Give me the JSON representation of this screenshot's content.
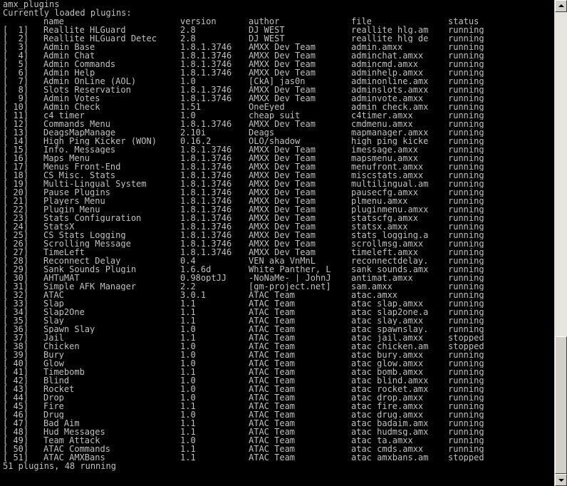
{
  "console": {
    "command": "amx_plugins",
    "heading": "Currently loaded plugins:",
    "columns": {
      "name": "name",
      "version": "version",
      "author": "author",
      "file": "file",
      "status": "status"
    },
    "plugins": [
      {
        "index": "[  1]",
        "name": "Reallite HLGuard",
        "version": "2.8",
        "author": "DJ_WEST",
        "file": "reallite_hlg.am",
        "status": "running"
      },
      {
        "index": "[  2]",
        "name": "Reallite HLGuard Detec",
        "version": "2.8",
        "author": "DJ_WEST",
        "file": "reallite_hlg_de",
        "status": "running"
      },
      {
        "index": "[  3]",
        "name": "Admin Base",
        "version": "1.8.1.3746",
        "author": "AMXX Dev Team",
        "file": "admin.amxx",
        "status": "running"
      },
      {
        "index": "[  4]",
        "name": "Admin Chat",
        "version": "1.8.1.3746",
        "author": "AMXX Dev Team",
        "file": "adminchat.amxx",
        "status": "running"
      },
      {
        "index": "[  5]",
        "name": "Admin Commands",
        "version": "1.8.1.3746",
        "author": "AMXX Dev Team",
        "file": "admincmd.amxx",
        "status": "running"
      },
      {
        "index": "[  6]",
        "name": "Admin Help",
        "version": "1.8.1.3746",
        "author": "AMXX Dev Team",
        "file": "adminhelp.amxx",
        "status": "running"
      },
      {
        "index": "[  7]",
        "name": "Admin OnLine (AOL)",
        "version": "1.0",
        "author": "[CkA] jas0n",
        "file": "adminonline.amx",
        "status": "running"
      },
      {
        "index": "[  8]",
        "name": "Slots Reservation",
        "version": "1.8.1.3746",
        "author": "AMXX Dev Team",
        "file": "adminslots.amxx",
        "status": "running"
      },
      {
        "index": "[  9]",
        "name": "Admin Votes",
        "version": "1.8.1.3746",
        "author": "AMXX Dev Team",
        "file": "adminvote.amxx",
        "status": "running"
      },
      {
        "index": "[ 10]",
        "name": "Admin Check",
        "version": "1.51",
        "author": "OneEyed",
        "file": "admin_check.amx",
        "status": "running"
      },
      {
        "index": "[ 11]",
        "name": "c4 timer",
        "version": "1.0",
        "author": "cheap_suit",
        "file": "c4timer.amxx",
        "status": "running"
      },
      {
        "index": "[ 12]",
        "name": "Commands Menu",
        "version": "1.8.1.3746",
        "author": "AMXX Dev Team",
        "file": "cmdmenu.amxx",
        "status": "running"
      },
      {
        "index": "[ 13]",
        "name": "DeagsMapManage",
        "version": "2.10i",
        "author": "Deags",
        "file": "mapmanager.amxx",
        "status": "running"
      },
      {
        "index": "[ 14]",
        "name": "High Ping Kicker (WON)",
        "version": "0.16.2",
        "author": "OLO/shadow",
        "file": "high_ping_kicke",
        "status": "running"
      },
      {
        "index": "[ 15]",
        "name": "Info. Messages",
        "version": "1.8.1.3746",
        "author": "AMXX Dev Team",
        "file": "imessage.amxx",
        "status": "running"
      },
      {
        "index": "[ 16]",
        "name": "Maps Menu",
        "version": "1.8.1.3746",
        "author": "AMXX Dev Team",
        "file": "mapsmenu.amxx",
        "status": "running"
      },
      {
        "index": "[ 17]",
        "name": "Menus Front-End",
        "version": "1.8.1.3746",
        "author": "AMXX Dev Team",
        "file": "menufront.amxx",
        "status": "running"
      },
      {
        "index": "[ 18]",
        "name": "CS Misc. Stats",
        "version": "1.8.1.3746",
        "author": "AMXX Dev Team",
        "file": "miscstats.amxx",
        "status": "running"
      },
      {
        "index": "[ 19]",
        "name": "Multi-Lingual System",
        "version": "1.8.1.3746",
        "author": "AMXX Dev Team",
        "file": "multilingual.am",
        "status": "running"
      },
      {
        "index": "[ 20]",
        "name": "Pause Plugins",
        "version": "1.8.1.3746",
        "author": "AMXX Dev Team",
        "file": "pausecfg.amxx",
        "status": "running"
      },
      {
        "index": "[ 21]",
        "name": "Players Menu",
        "version": "1.8.1.3746",
        "author": "AMXX Dev Team",
        "file": "plmenu.amxx",
        "status": "running"
      },
      {
        "index": "[ 22]",
        "name": "Plugin Menu",
        "version": "1.8.1.3746",
        "author": "AMXX Dev Team",
        "file": "pluginmenu.amxx",
        "status": "running"
      },
      {
        "index": "[ 23]",
        "name": "Stats Configuration",
        "version": "1.8.1.3746",
        "author": "AMXX Dev Team",
        "file": "statscfg.amxx",
        "status": "running"
      },
      {
        "index": "[ 24]",
        "name": "StatsX",
        "version": "1.8.1.3746",
        "author": "AMXX Dev Team",
        "file": "statsx.amxx",
        "status": "running"
      },
      {
        "index": "[ 25]",
        "name": "CS Stats Logging",
        "version": "1.8.1.3746",
        "author": "AMXX Dev Team",
        "file": "stats_logging.a",
        "status": "running"
      },
      {
        "index": "[ 26]",
        "name": "Scrolling Message",
        "version": "1.8.1.3746",
        "author": "AMXX Dev Team",
        "file": "scrollmsg.amxx",
        "status": "running"
      },
      {
        "index": "[ 27]",
        "name": "TimeLeft",
        "version": "1.8.1.3746",
        "author": "AMXX Dev Team",
        "file": "timeleft.amxx",
        "status": "running"
      },
      {
        "index": "[ 28]",
        "name": "Reconnect Delay",
        "version": "0.4",
        "author": "VEN aka VnMnL",
        "file": "reconnectdelay.",
        "status": "running"
      },
      {
        "index": "[ 29]",
        "name": "Sank Sounds Plugin",
        "version": "1.6.6d",
        "author": "White Panther, L",
        "file": "sank_sounds.amx",
        "status": "running"
      },
      {
        "index": "[ 30]",
        "name": "AHTuMAT",
        "version": "0.98optJJ",
        "author": "-NoNaMe- | JohnJ",
        "file": "antimat.amxx",
        "status": "running"
      },
      {
        "index": "[ 31]",
        "name": "Simple AFK Manager",
        "version": "2.2",
        "author": "[gm-project.net]",
        "file": "sam.amxx",
        "status": "running"
      },
      {
        "index": "[ 32]",
        "name": "ATAC",
        "version": "3.0.1",
        "author": "ATAC Team",
        "file": "atac.amxx",
        "status": "running"
      },
      {
        "index": "[ 33]",
        "name": "Slap",
        "version": "1.1",
        "author": "ATAC Team",
        "file": "atac_slap.amxx",
        "status": "running"
      },
      {
        "index": "[ 34]",
        "name": "Slap2One",
        "version": "1.1",
        "author": "ATAC Team",
        "file": "atac_slap2one.a",
        "status": "running"
      },
      {
        "index": "[ 35]",
        "name": "Slay",
        "version": "1.1",
        "author": "ATAC Team",
        "file": "atac_slay.amxx",
        "status": "running"
      },
      {
        "index": "[ 36]",
        "name": "Spawn Slay",
        "version": "1.0",
        "author": "ATAC Team",
        "file": "atac_spawnslay.",
        "status": "running"
      },
      {
        "index": "[ 37]",
        "name": "Jail",
        "version": "1.1",
        "author": "ATAC Team",
        "file": "atac_jail.amxx",
        "status": "stopped"
      },
      {
        "index": "[ 38]",
        "name": "Chicken",
        "version": "1.0",
        "author": "ATAC Team",
        "file": "atac_chicken.am",
        "status": "stopped"
      },
      {
        "index": "[ 39]",
        "name": "Bury",
        "version": "1.0",
        "author": "ATAC Team",
        "file": "atac_bury.amxx",
        "status": "running"
      },
      {
        "index": "[ 40]",
        "name": "Glow",
        "version": "1.0",
        "author": "ATAC Team",
        "file": "atac_glow.amxx",
        "status": "running"
      },
      {
        "index": "[ 41]",
        "name": "Timebomb",
        "version": "1.1",
        "author": "ATAC Team",
        "file": "atac_bomb.amxx",
        "status": "running"
      },
      {
        "index": "[ 42]",
        "name": "Blind",
        "version": "1.0",
        "author": "ATAC Team",
        "file": "atac_blind.amxx",
        "status": "running"
      },
      {
        "index": "[ 43]",
        "name": "Rocket",
        "version": "1.0",
        "author": "ATAC Team",
        "file": "atac_rocket.amx",
        "status": "running"
      },
      {
        "index": "[ 44]",
        "name": "Drop",
        "version": "1.0",
        "author": "ATAC Team",
        "file": "atac_drop.amxx",
        "status": "running"
      },
      {
        "index": "[ 45]",
        "name": "Fire",
        "version": "1.1",
        "author": "ATAC Team",
        "file": "atac_fire.amxx",
        "status": "running"
      },
      {
        "index": "[ 46]",
        "name": "Drug",
        "version": "1.0",
        "author": "ATAC Team",
        "file": "atac_drug.amxx",
        "status": "running"
      },
      {
        "index": "[ 47]",
        "name": "Bad Aim",
        "version": "1.1",
        "author": "ATAC Team",
        "file": "atac_badaim.amx",
        "status": "running"
      },
      {
        "index": "[ 48]",
        "name": "Hud Messages",
        "version": "1.1",
        "author": "ATAC Team",
        "file": "atac_hudmsg.amx",
        "status": "running"
      },
      {
        "index": "[ 49]",
        "name": "Team Attack",
        "version": "1.0",
        "author": "ATAC Team",
        "file": "atac_ta.amxx",
        "status": "running"
      },
      {
        "index": "[ 50]",
        "name": "ATAC Commands",
        "version": "1.1",
        "author": "ATAC Team",
        "file": "atac_cmds.amxx",
        "status": "running"
      },
      {
        "index": "[ 51]",
        "name": "ATAC AMXBans",
        "version": "1.1",
        "author": "ATAC Team",
        "file": "atac_amxbans.am",
        "status": "stopped"
      }
    ],
    "summary": "51 plugins, 48 running"
  },
  "colors": {
    "background": "#000000",
    "text": "#c0c0c0",
    "scrollbar_face": "#d4d0c8",
    "scrollbar_track": "#e8e5de"
  }
}
